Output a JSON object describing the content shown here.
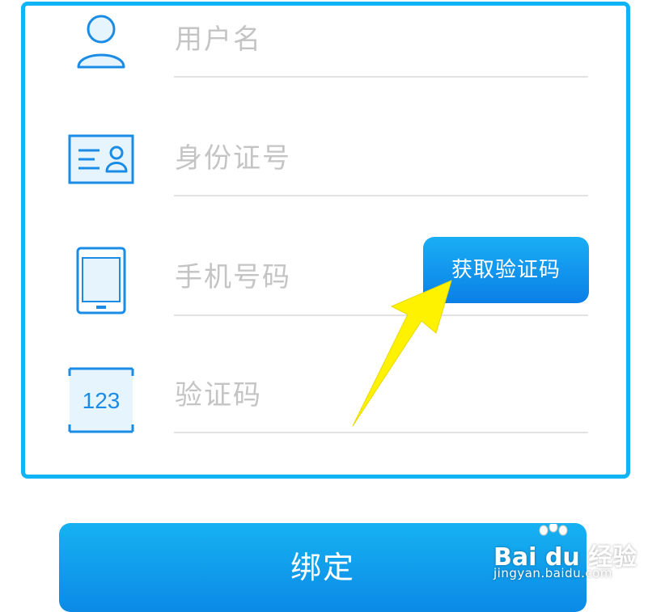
{
  "colors": {
    "frame": "#0fb4f7",
    "primary": "#0a8fe8",
    "placeholder": "#c4c4c4",
    "arrow": "#fff200"
  },
  "form": {
    "fields": [
      {
        "icon": "user-icon",
        "placeholder": "用户名"
      },
      {
        "icon": "id-card-icon",
        "placeholder": "身份证号"
      },
      {
        "icon": "phone-icon",
        "placeholder": "手机号码"
      },
      {
        "icon": "code-123-icon",
        "placeholder": "验证码",
        "icon_text": "123"
      }
    ],
    "get_code_label": "获取验证码"
  },
  "bind_label": "绑定",
  "watermark": {
    "brand": "Bai du 经验",
    "url": "jingyan.baidu.com"
  }
}
